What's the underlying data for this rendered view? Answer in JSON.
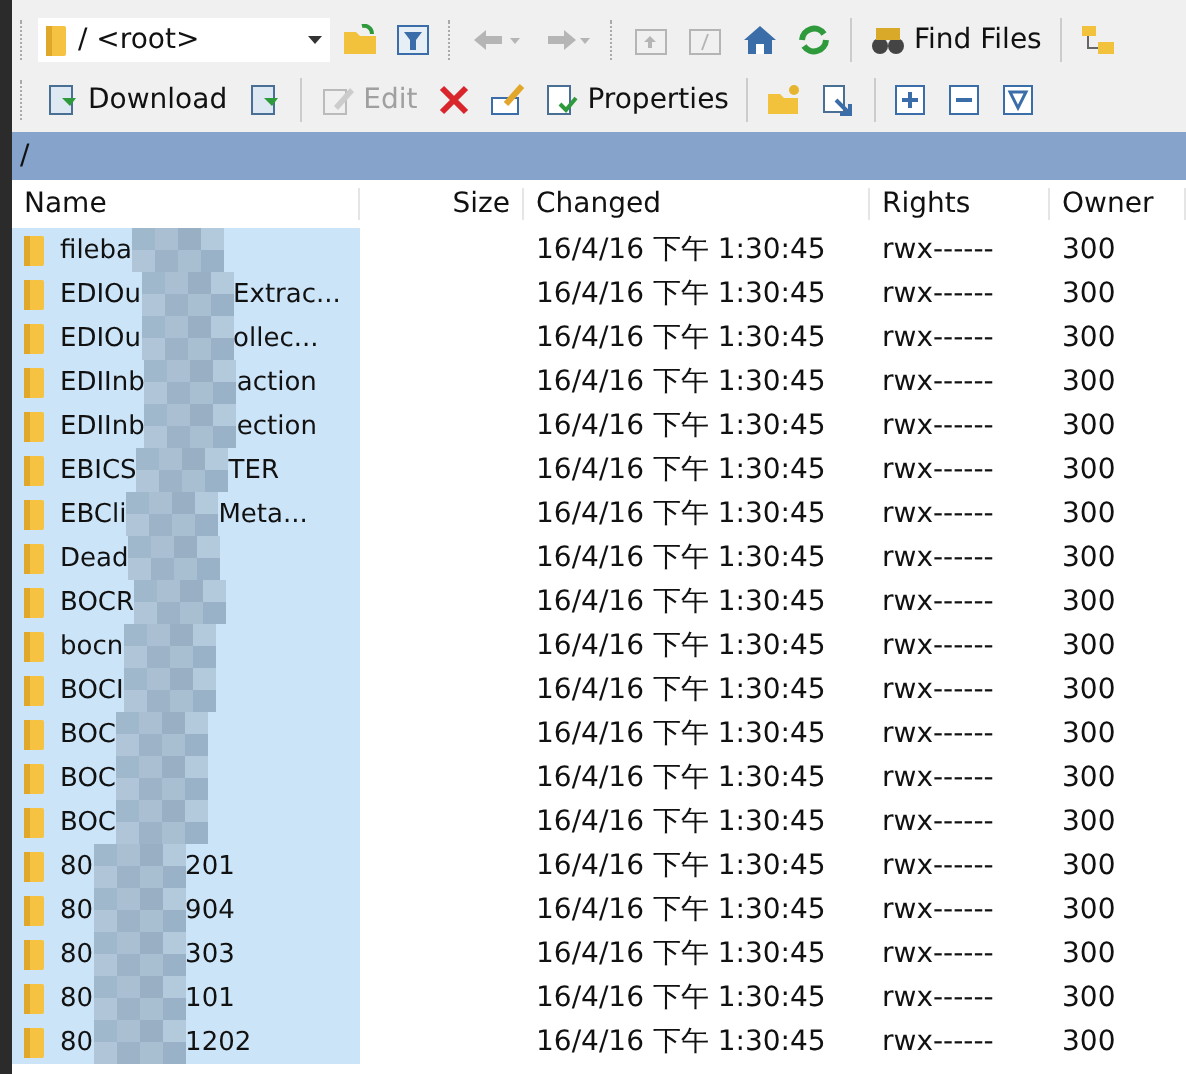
{
  "path_combo": {
    "value": "/ <root>"
  },
  "nav": {
    "back_disabled": true,
    "forward_disabled": true,
    "parent_disabled": true,
    "root_disabled": true
  },
  "find_button": {
    "label": "Find Files"
  },
  "actions": [
    {
      "kind": "download",
      "label": "Download",
      "disabled": false
    },
    {
      "kind": "edit",
      "label": "Edit",
      "disabled": true
    },
    {
      "kind": "properties",
      "label": "Properties",
      "disabled": false
    }
  ],
  "path_bar": {
    "path": "/"
  },
  "table": {
    "columns": [
      "Name",
      "Size",
      "Changed",
      "Rights",
      "Owner"
    ],
    "rows": [
      {
        "name_start": "fileba",
        "name_end": "",
        "changed": "16/4/16 下午 1:30:45",
        "rights": "rwx------",
        "owner": "300",
        "selected": true
      },
      {
        "name_start": "EDIOu",
        "name_end": "Extrac...",
        "changed": "16/4/16 下午 1:30:45",
        "rights": "rwx------",
        "owner": "300",
        "selected": true
      },
      {
        "name_start": "EDIOu",
        "name_end": "ollec...",
        "changed": "16/4/16 下午 1:30:45",
        "rights": "rwx------",
        "owner": "300",
        "selected": true
      },
      {
        "name_start": "EDIInb",
        "name_end": "action",
        "changed": "16/4/16 下午 1:30:45",
        "rights": "rwx------",
        "owner": "300",
        "selected": true
      },
      {
        "name_start": "EDIInb",
        "name_end": "ection",
        "changed": "16/4/16 下午 1:30:45",
        "rights": "rwx------",
        "owner": "300",
        "selected": true
      },
      {
        "name_start": "EBICS",
        "name_end": "TER",
        "changed": "16/4/16 下午 1:30:45",
        "rights": "rwx------",
        "owner": "300",
        "selected": true
      },
      {
        "name_start": "EBCli",
        "name_end": "Meta...",
        "changed": "16/4/16 下午 1:30:45",
        "rights": "rwx------",
        "owner": "300",
        "selected": true
      },
      {
        "name_start": "Dead",
        "name_end": "",
        "changed": "16/4/16 下午 1:30:45",
        "rights": "rwx------",
        "owner": "300",
        "selected": true
      },
      {
        "name_start": "BOCR",
        "name_end": "",
        "changed": "16/4/16 下午 1:30:45",
        "rights": "rwx------",
        "owner": "300",
        "selected": true
      },
      {
        "name_start": "bocn",
        "name_end": "",
        "changed": "16/4/16 下午 1:30:45",
        "rights": "rwx------",
        "owner": "300",
        "selected": true
      },
      {
        "name_start": "BOCI",
        "name_end": "",
        "changed": "16/4/16 下午 1:30:45",
        "rights": "rwx------",
        "owner": "300",
        "selected": true
      },
      {
        "name_start": "BOC",
        "name_end": "",
        "changed": "16/4/16 下午 1:30:45",
        "rights": "rwx------",
        "owner": "300",
        "selected": true
      },
      {
        "name_start": "BOC",
        "name_end": "",
        "changed": "16/4/16 下午 1:30:45",
        "rights": "rwx------",
        "owner": "300",
        "selected": true
      },
      {
        "name_start": "BOC",
        "name_end": "",
        "changed": "16/4/16 下午 1:30:45",
        "rights": "rwx------",
        "owner": "300",
        "selected": true
      },
      {
        "name_start": "80",
        "name_end": "201",
        "changed": "16/4/16 下午 1:30:45",
        "rights": "rwx------",
        "owner": "300",
        "selected": true
      },
      {
        "name_start": "80",
        "name_end": "904",
        "changed": "16/4/16 下午 1:30:45",
        "rights": "rwx------",
        "owner": "300",
        "selected": true
      },
      {
        "name_start": "80",
        "name_end": "303",
        "changed": "16/4/16 下午 1:30:45",
        "rights": "rwx------",
        "owner": "300",
        "selected": true
      },
      {
        "name_start": "80",
        "name_end": "101",
        "changed": "16/4/16 下午 1:30:45",
        "rights": "rwx------",
        "owner": "300",
        "selected": true
      },
      {
        "name_start": "80",
        "name_end": "1202",
        "changed": "16/4/16 下午 1:30:45",
        "rights": "rwx------",
        "owner": "300",
        "selected": true
      }
    ]
  }
}
